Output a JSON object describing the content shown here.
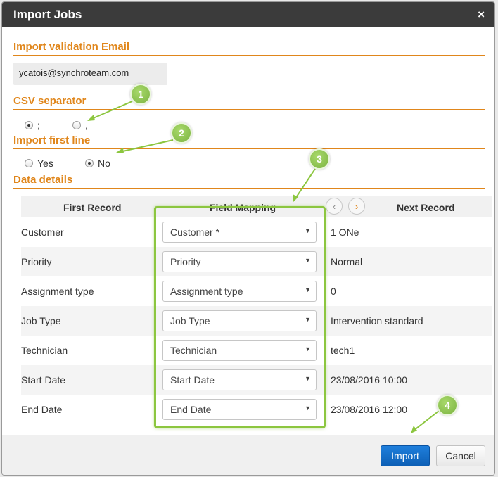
{
  "dialog": {
    "title": "Import Jobs",
    "close_glyph": "×"
  },
  "sections": {
    "email": "Import validation Email",
    "csv": "CSV separator",
    "first_line": "Import first line",
    "data": "Data details"
  },
  "email": {
    "value": "ycatois@synchroteam.com"
  },
  "csv_options": [
    {
      "label": ";",
      "checked": true
    },
    {
      "label": ",",
      "checked": false
    }
  ],
  "first_line_options": [
    {
      "label": "Yes",
      "checked": false
    },
    {
      "label": "No",
      "checked": true
    }
  ],
  "table": {
    "headers": {
      "first_record": "First Record",
      "field_mapping": "Field Mapping",
      "next_record": "Next Record"
    },
    "prev_glyph": "‹",
    "next_glyph": "›",
    "rows": [
      {
        "label": "Customer",
        "mapping": "Customer *",
        "next": "1 ONe"
      },
      {
        "label": "Priority",
        "mapping": "Priority",
        "next": "Normal"
      },
      {
        "label": "Assignment type",
        "mapping": "Assignment type",
        "next": "0"
      },
      {
        "label": "Job Type",
        "mapping": "Job Type",
        "next": "Intervention standard"
      },
      {
        "label": "Technician",
        "mapping": "Technician",
        "next": "tech1"
      },
      {
        "label": "Start Date",
        "mapping": "Start Date",
        "next": "23/08/2016 10:00"
      },
      {
        "label": "End Date",
        "mapping": "End Date",
        "next": "23/08/2016 12:00"
      }
    ]
  },
  "footer": {
    "import_label": "Import",
    "cancel_label": "Cancel"
  },
  "callouts": [
    "1",
    "2",
    "3",
    "4"
  ],
  "colors": {
    "accent": "#e0861b",
    "titlebar": "#3b3b3b",
    "primary_button": "#1a73cf",
    "callout": "#8cc63f"
  }
}
